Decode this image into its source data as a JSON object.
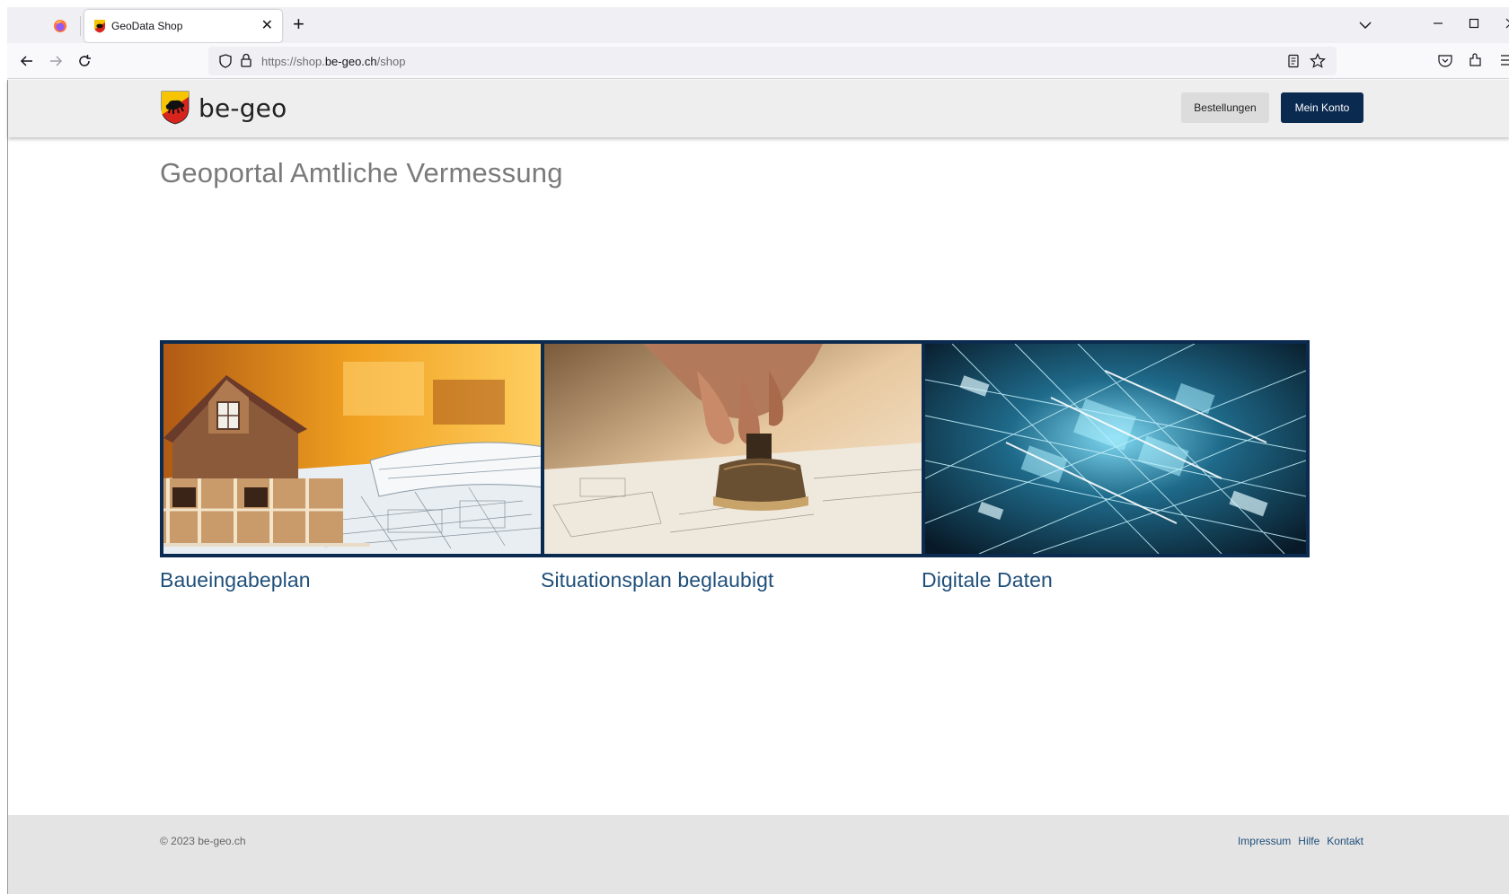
{
  "browser": {
    "tab_title": "GeoData Shop",
    "url_prefix": "https://shop.",
    "url_domain": "be-geo.ch",
    "url_path": "/shop"
  },
  "header": {
    "logo_text": "be-geo",
    "orders_label": "Bestellungen",
    "account_label": "Mein Konto"
  },
  "main": {
    "title": "Geoportal Amtliche Vermessung",
    "cards": [
      {
        "label": "Baueingabeplan",
        "image": "house-model-on-blueprint"
      },
      {
        "label": "Situationsplan beglaubigt",
        "image": "hand-stamping-plan"
      },
      {
        "label": "Digitale Daten",
        "image": "digital-circuit-grid"
      }
    ]
  },
  "footer": {
    "copyright": "© 2023 be-geo.ch",
    "links": [
      "Impressum",
      "Hilfe",
      "Kontakt"
    ]
  },
  "colors": {
    "brand_navy": "#0b2a50",
    "link_blue": "#1f4f7a",
    "header_bg": "#eeeeee",
    "footer_bg": "#e4e4e4"
  }
}
